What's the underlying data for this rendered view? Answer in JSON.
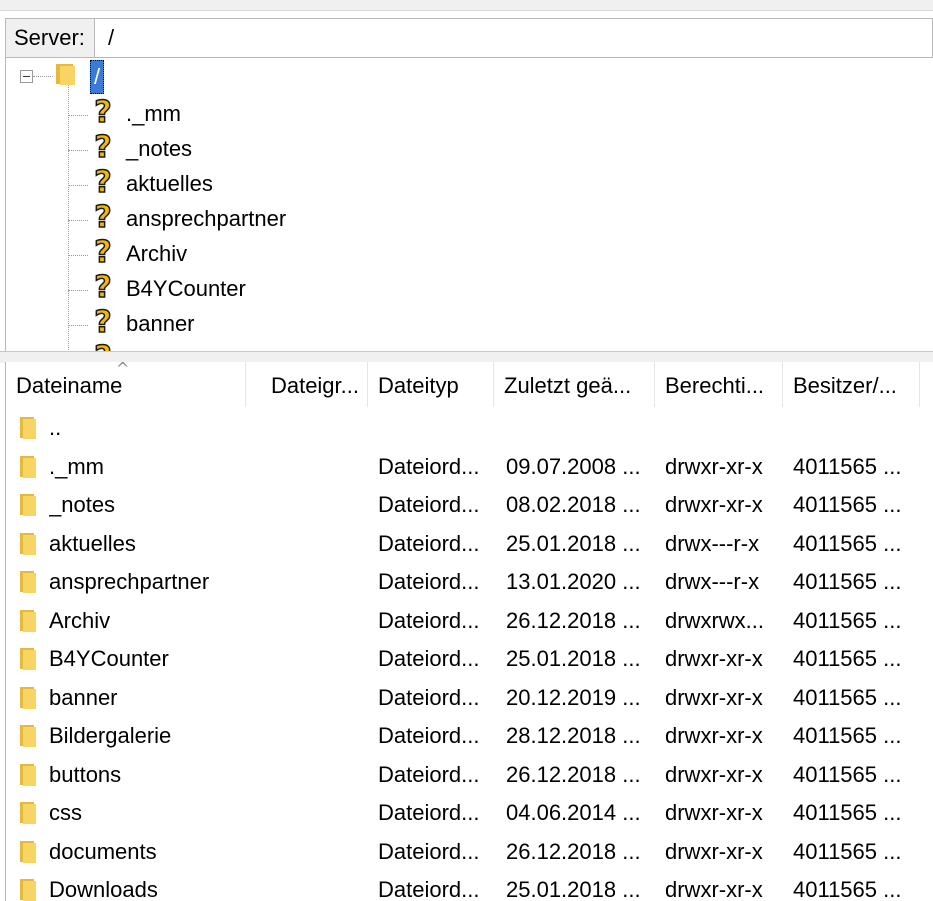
{
  "server": {
    "label": "Server:",
    "path": "/"
  },
  "tree": {
    "root_label": "/",
    "items": [
      {
        "label": "._mm"
      },
      {
        "label": "_notes"
      },
      {
        "label": "aktuelles"
      },
      {
        "label": "ansprechpartner"
      },
      {
        "label": "Archiv"
      },
      {
        "label": "B4YCounter"
      },
      {
        "label": "banner"
      }
    ]
  },
  "list": {
    "columns": [
      "Dateiname",
      "Dateigr...",
      "Dateityp",
      "Zuletzt geä...",
      "Berechti...",
      "Besitzer/..."
    ],
    "sort_indicator": "^",
    "rows": [
      {
        "name": "..",
        "size": "",
        "type": "",
        "modified": "",
        "perms": "",
        "owner": ""
      },
      {
        "name": "._mm",
        "size": "",
        "type": "Dateiord...",
        "modified": "09.07.2008 ...",
        "perms": "drwxr-xr-x",
        "owner": "4011565 ..."
      },
      {
        "name": "_notes",
        "size": "",
        "type": "Dateiord...",
        "modified": "08.02.2018 ...",
        "perms": "drwxr-xr-x",
        "owner": "4011565 ..."
      },
      {
        "name": "aktuelles",
        "size": "",
        "type": "Dateiord...",
        "modified": "25.01.2018 ...",
        "perms": "drwx---r-x",
        "owner": "4011565 ..."
      },
      {
        "name": "ansprechpartner",
        "size": "",
        "type": "Dateiord...",
        "modified": "13.01.2020 ...",
        "perms": "drwx---r-x",
        "owner": "4011565 ..."
      },
      {
        "name": "Archiv",
        "size": "",
        "type": "Dateiord...",
        "modified": "26.12.2018 ...",
        "perms": "drwxrwx...",
        "owner": "4011565 ..."
      },
      {
        "name": "B4YCounter",
        "size": "",
        "type": "Dateiord...",
        "modified": "25.01.2018 ...",
        "perms": "drwxr-xr-x",
        "owner": "4011565 ..."
      },
      {
        "name": "banner",
        "size": "",
        "type": "Dateiord...",
        "modified": "20.12.2019 ...",
        "perms": "drwxr-xr-x",
        "owner": "4011565 ..."
      },
      {
        "name": "Bildergalerie",
        "size": "",
        "type": "Dateiord...",
        "modified": "28.12.2018 ...",
        "perms": "drwxr-xr-x",
        "owner": "4011565 ..."
      },
      {
        "name": "buttons",
        "size": "",
        "type": "Dateiord...",
        "modified": "26.12.2018 ...",
        "perms": "drwxr-xr-x",
        "owner": "4011565 ..."
      },
      {
        "name": "css",
        "size": "",
        "type": "Dateiord...",
        "modified": "04.06.2014 ...",
        "perms": "drwxr-xr-x",
        "owner": "4011565 ..."
      },
      {
        "name": "documents",
        "size": "",
        "type": "Dateiord...",
        "modified": "26.12.2018 ...",
        "perms": "drwxr-xr-x",
        "owner": "4011565 ..."
      },
      {
        "name": "Downloads",
        "size": "",
        "type": "Dateiord...",
        "modified": "25.01.2018 ...",
        "perms": "drwxr-xr-x",
        "owner": "4011565 ..."
      }
    ]
  },
  "icons": {
    "folder": "folder-icon",
    "unknown": "question-mark-icon",
    "expander": "minus-box-icon"
  },
  "colors": {
    "folder": "#f2c94c",
    "selection": "#3b7bd6",
    "question": "#f5b800"
  }
}
